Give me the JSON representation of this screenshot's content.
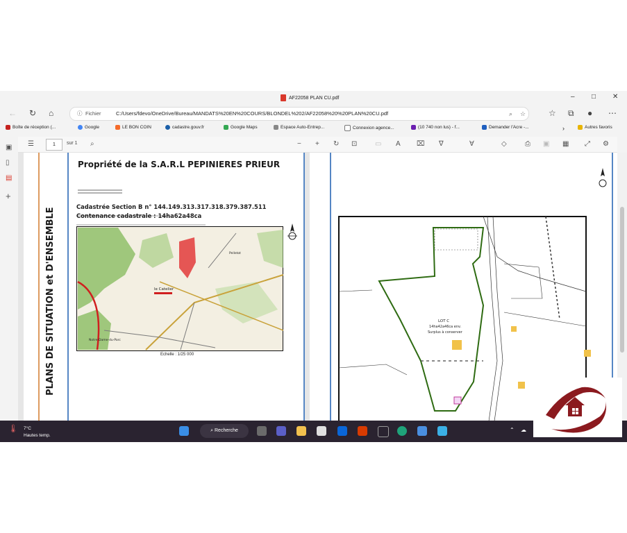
{
  "window": {
    "title": "AF22058 PLAN CU.pdf",
    "minimize": "–",
    "maximize": "□",
    "close": "✕"
  },
  "address_bar": {
    "scheme_label": "Fichier",
    "url": "C:/Users/fdevo/OneDrive/Bureau/MANDATS%20EN%20COURS/BLONDEL%202/AF22058%20%20PLAN%20CU.pdf"
  },
  "bookmarks": [
    {
      "label": "Boîte de réception (...",
      "icon": "gmail-icon",
      "color": "#c5221f"
    },
    {
      "label": "Google",
      "icon": "google-icon",
      "color": "#4285f4"
    },
    {
      "label": "LE BON COIN",
      "icon": "leboncoin-icon",
      "color": "#f56b2a"
    },
    {
      "label": "cadastre.gouv.fr",
      "icon": "cadastre-icon",
      "color": "#1b5fa8"
    },
    {
      "label": "Google Maps",
      "icon": "maps-icon",
      "color": "#34a853"
    },
    {
      "label": "Espace Auto-Entrep...",
      "icon": "page-icon",
      "color": "#888888"
    },
    {
      "label": "Connexion agence...",
      "icon": "doc-icon",
      "color": "#777777"
    },
    {
      "label": "(10 740 non lus) - f...",
      "icon": "mail-icon",
      "color": "#6b1fb0"
    },
    {
      "label": "Demander l'Acre -...",
      "icon": "flag-icon",
      "color": "#1f5fbf"
    },
    {
      "label": "Autres favoris",
      "icon": "folder-icon",
      "color": "#e8b400"
    }
  ],
  "pdf_toolbar": {
    "page_number": "1",
    "page_total": "sur 1"
  },
  "document": {
    "heading": "Propriété de la  S.A.R.L  PEPINIERES PRIEUR",
    "vertical_title": "PLANS DE SITUATION et D'ENSEMBLE",
    "cadastre_line": "Cadastrée Section  B n° 144.149.313.317.318.379.387.511",
    "contenance_line": "Contenance cadastrale :   14ha62a48ca",
    "map_place_1": "le Catelier",
    "map_place_2": "Notre-Dame-du-Parc",
    "map_place_3": "Pelletot",
    "scale": "Echelle : 1/25 000",
    "lot_title": "LOT C",
    "lot_area": "14ha42a46ca env.",
    "lot_note": "Surplus à conserver"
  },
  "taskbar": {
    "temperature": "7°C",
    "weather": "Hautes temp.",
    "search_label": "Recherche"
  },
  "colors": {
    "taskbar": "#2a2330",
    "map_border": "#111111",
    "parcel_green": "#2e6b12",
    "logo_red": "#8b1a1f"
  }
}
